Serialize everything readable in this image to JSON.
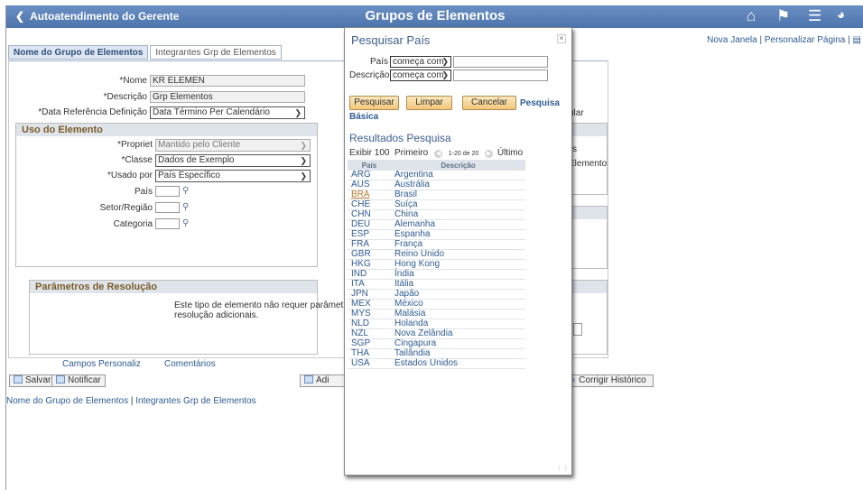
{
  "header": {
    "back_label": "Autoatendimento do Gerente",
    "title": "Grupos de Elementos",
    "links": {
      "new_window": "Nova Janela",
      "personalize": "Personalizar Página"
    }
  },
  "tabs": [
    {
      "label": "Nome do Grupo de Elementos"
    },
    {
      "label": "Integrantes Grp de Elementos"
    }
  ],
  "form": {
    "nome": {
      "label": "*Nome",
      "value": "KR ELEMEN"
    },
    "descricao": {
      "label": "*Descrição",
      "value": "Grp Elementos"
    },
    "data_ref": {
      "label": "*Data Referência Definição",
      "value": "Data Término Per Calendário"
    },
    "peek_right_1": "ular"
  },
  "uso": {
    "title": "Uso do Elemento",
    "propriet": {
      "label": "*Propriet",
      "value": "Mantido pelo Cliente"
    },
    "classe": {
      "label": "*Classe",
      "value": "Dados de Exemplo"
    },
    "usado_por": {
      "label": "*Usado por",
      "value": "País Específico"
    },
    "pais": {
      "label": "País"
    },
    "setor": {
      "label": "Setor/Região"
    },
    "categoria": {
      "label": "Categoria"
    },
    "peek_right_1": "s",
    "peek_right_2": "Elemento"
  },
  "resolucao": {
    "title": "Parâmetros de Resolução",
    "text_line1": "Este tipo de elemento não requer parâmetros d",
    "text_line2": "resolução adicionais."
  },
  "footer": {
    "campos": "Campos Personaliz",
    "comentarios": "Comentários",
    "salvar": "Salvar",
    "notificar": "Notificar",
    "adi": "Adi",
    "corrigir": "Corrigir Histórico",
    "bottom_link_1": "Nome do Grupo de Elementos",
    "bottom_sep": " | ",
    "bottom_link_2": "Integrantes Grp de Elementos"
  },
  "modal": {
    "title": "Pesquisar País",
    "close": "×",
    "pais_label": "País",
    "pais_op": "começa com",
    "desc_label": "Descrição",
    "desc_op": "começa com",
    "btn_pesquisar": "Pesquisar",
    "btn_limpar": "Limpar",
    "btn_cancelar": "Cancelar",
    "link_basica_1": "Pesquisa",
    "link_basica_2": "Básica",
    "results_title": "Resultados Pesquisa",
    "exibir": "Exibir 100",
    "primeiro": "Primeiro",
    "range": "1-20 de 20",
    "ultimo": "Último",
    "col_pais": "País",
    "col_desc": "Descrição",
    "rows": [
      {
        "code": "ARG",
        "name": "Argentina"
      },
      {
        "code": "AUS",
        "name": "Austrália"
      },
      {
        "code": "BRA",
        "name": "Brasil"
      },
      {
        "code": "CHE",
        "name": "Suíça"
      },
      {
        "code": "CHN",
        "name": "China"
      },
      {
        "code": "DEU",
        "name": "Alemanha"
      },
      {
        "code": "ESP",
        "name": "Espanha"
      },
      {
        "code": "FRA",
        "name": "França"
      },
      {
        "code": "GBR",
        "name": "Reino Unido"
      },
      {
        "code": "HKG",
        "name": "Hong Kong"
      },
      {
        "code": "IND",
        "name": "Índia"
      },
      {
        "code": "ITA",
        "name": "Itália"
      },
      {
        "code": "JPN",
        "name": "Japão"
      },
      {
        "code": "MEX",
        "name": "México"
      },
      {
        "code": "MYS",
        "name": "Malásia"
      },
      {
        "code": "NLD",
        "name": "Holanda"
      },
      {
        "code": "NZL",
        "name": "Nova Zelândia"
      },
      {
        "code": "SGP",
        "name": "Cingapura"
      },
      {
        "code": "THA",
        "name": "Tailândia"
      },
      {
        "code": "USA",
        "name": "Estados Unidos"
      }
    ]
  }
}
